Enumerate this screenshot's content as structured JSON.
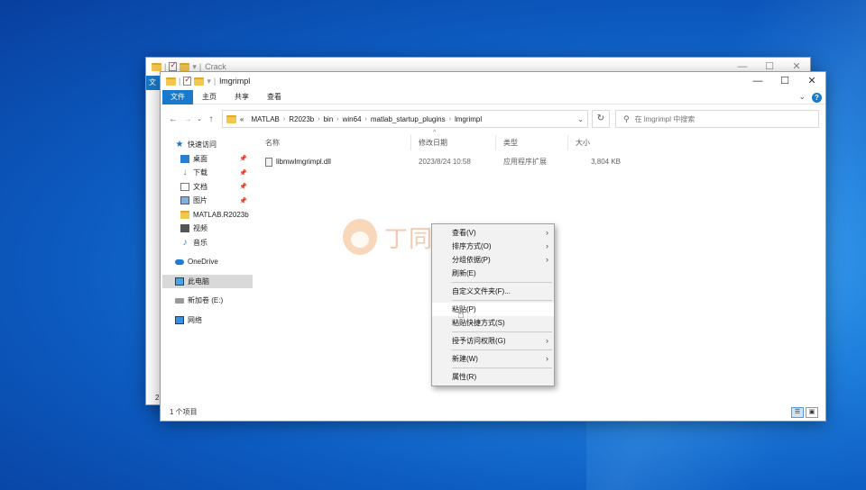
{
  "back_window": {
    "title": "Crack",
    "visible_tab": "文",
    "bottom_text": "2"
  },
  "window": {
    "title": "lmgrimpl",
    "controls": {
      "minimize": "—",
      "maximize": "☐",
      "close": "✕"
    }
  },
  "ribbon": {
    "tabs": [
      "文件",
      "主页",
      "共享",
      "查看"
    ],
    "help": "?"
  },
  "address": {
    "prefix": "«",
    "crumbs": [
      "MATLAB",
      "R2023b",
      "bin",
      "win64",
      "matlab_startup_plugins",
      "lmgrimpl"
    ]
  },
  "search": {
    "placeholder": "在 lmgrimpl 中搜索"
  },
  "nav": {
    "quick_access": "快速访问",
    "items": [
      {
        "label": "桌面",
        "pinned": true
      },
      {
        "label": "下载",
        "pinned": true
      },
      {
        "label": "文档",
        "pinned": true
      },
      {
        "label": "图片",
        "pinned": true
      },
      {
        "label": "MATLAB.R2023b"
      },
      {
        "label": "视频"
      },
      {
        "label": "音乐"
      }
    ],
    "onedrive": "OneDrive",
    "this_pc": "此电脑",
    "drive": "新加卷 (E:)",
    "network": "网络"
  },
  "columns": {
    "name": "名称",
    "modified": "修改日期",
    "type": "类型",
    "size": "大小"
  },
  "files": [
    {
      "name": "libmwlmgrimpl.dll",
      "modified": "2023/8/24 10:58",
      "type": "应用程序扩展",
      "size": "3,804 KB"
    }
  ],
  "status": {
    "count": "1 个项目"
  },
  "context_menu": {
    "view": "查看(V)",
    "sort": "排序方式(O)",
    "group": "分组依据(P)",
    "refresh": "刷新(E)",
    "customize": "自定义文件夹(F)...",
    "paste": "粘贴(P)",
    "paste_shortcut": "粘贴快捷方式(S)",
    "grant_access": "授予访问权限(G)",
    "new": "新建(W)",
    "properties": "属性(R)"
  },
  "watermark": {
    "text": "丁同学笔记本"
  }
}
